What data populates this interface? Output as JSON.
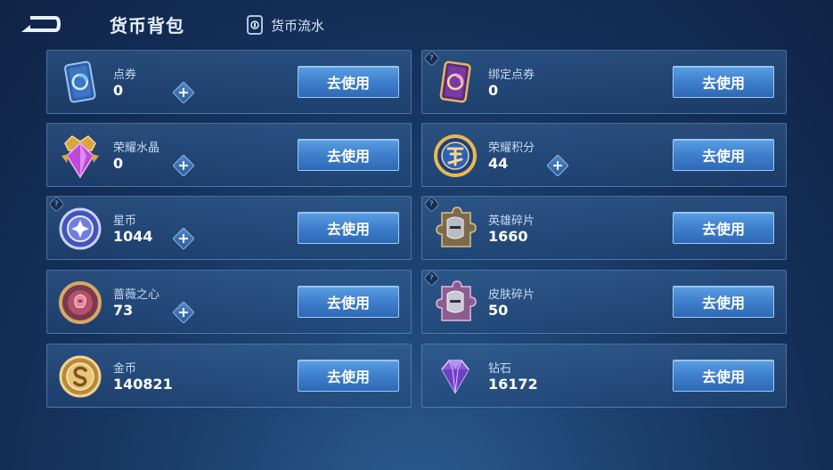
{
  "header": {
    "title": "货币背包",
    "flow_label": "货币流水"
  },
  "currencies": [
    {
      "name": "点券",
      "value": "0",
      "button": "去使用",
      "icon": "voucher-card-icon"
    },
    {
      "name": "绑定点券",
      "value": "0",
      "button": "去使用",
      "icon": "bound-voucher-card-icon"
    },
    {
      "name": "荣耀水晶",
      "value": "0",
      "button": "去使用",
      "icon": "honor-crystal-icon"
    },
    {
      "name": "荣耀积分",
      "value": "44",
      "button": "去使用",
      "icon": "honor-points-icon"
    },
    {
      "name": "星币",
      "value": "1044",
      "button": "去使用",
      "icon": "star-coin-icon"
    },
    {
      "name": "英雄碎片",
      "value": "1660",
      "button": "去使用",
      "icon": "hero-fragment-icon"
    },
    {
      "name": "蔷薇之心",
      "value": "73",
      "button": "去使用",
      "icon": "rose-heart-icon"
    },
    {
      "name": "皮肤碎片",
      "value": "50",
      "button": "去使用",
      "icon": "skin-fragment-icon"
    },
    {
      "name": "金币",
      "value": "140821",
      "button": "去使用",
      "icon": "gold-coin-icon"
    },
    {
      "name": "钻石",
      "value": "16172",
      "button": "去使用",
      "icon": "diamond-icon"
    }
  ],
  "colors": {
    "background": "#1d4371",
    "button": "#3f80cc",
    "card_border": "#78aae1"
  }
}
